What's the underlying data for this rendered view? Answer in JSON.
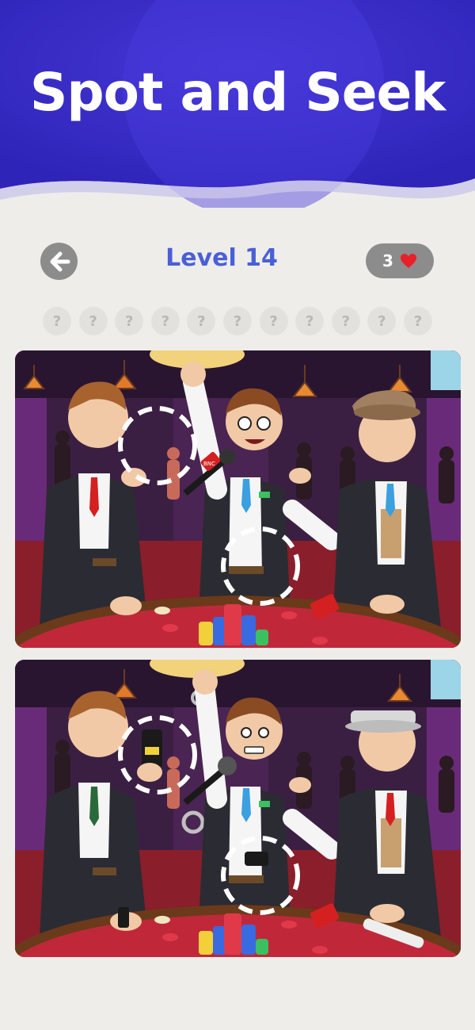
{
  "header": {
    "title": "Spot and Seek"
  },
  "level_bar": {
    "back_icon": "arrow-left-icon",
    "level_label": "Level 14",
    "lives": "3",
    "lives_icon": "heart-icon"
  },
  "progress": {
    "slots": [
      "?",
      "?",
      "?",
      "?",
      "?",
      "?",
      "?",
      "?",
      "?",
      "?",
      "?"
    ]
  },
  "scene": {
    "top_mic_text": "BNC",
    "found_markers": 2
  },
  "colors": {
    "banner": "#3b2fc9",
    "level_text": "#4a5fd6",
    "heart": "#e8202a",
    "button_gray": "#8c8c8c"
  }
}
